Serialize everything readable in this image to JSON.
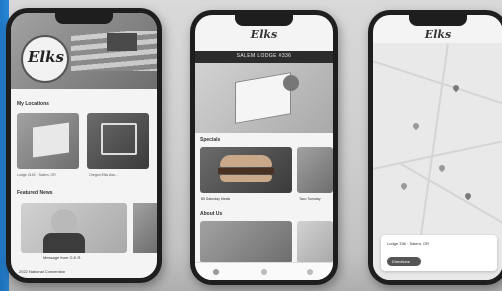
{
  "phone1": {
    "logo": "Elks",
    "section_locations": "My Locations",
    "card1_caption": "Lodge 2143 · Salem, OR",
    "card2_caption": "Oregon Elks Ass...",
    "section_news": "Featured News",
    "news_headline": "Message from G.E.R.",
    "footer_text": "2022 National Convention"
  },
  "phone2": {
    "logo": "Elks",
    "header": "SALEM LODGE #336",
    "section_specials": "Specials",
    "special_caption": "$5 Saturday Meals",
    "special_caption2": "Taco Tuesday",
    "section_about": "About Us"
  },
  "phone3": {
    "logo": "Elks",
    "lodge_label": "Lodge 336 · Salem, OR",
    "directions_label": "Directions"
  }
}
